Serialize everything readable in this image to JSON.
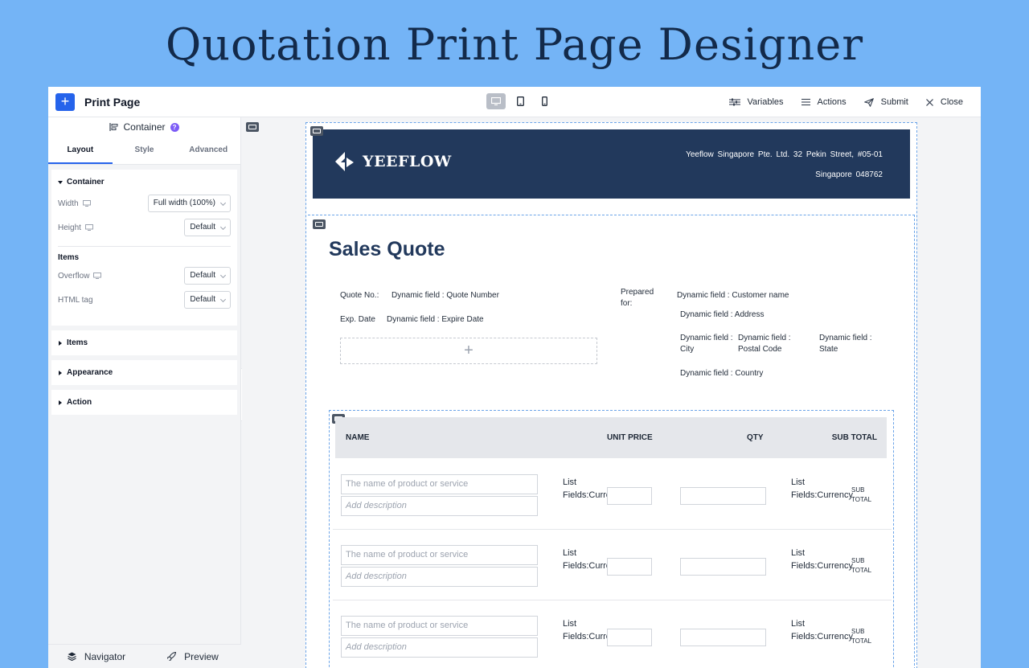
{
  "page": {
    "title": "Quotation Print Page Designer"
  },
  "topbar": {
    "add_label": "+",
    "title": "Print Page",
    "devices": [
      "desktop-icon",
      "tablet-icon",
      "mobile-icon"
    ],
    "actions": [
      {
        "label": "Variables",
        "icon": "sliders-icon"
      },
      {
        "label": "Actions",
        "icon": "list-icon"
      },
      {
        "label": "Submit",
        "icon": "send-icon"
      },
      {
        "label": "Close",
        "icon": "close-icon"
      }
    ]
  },
  "panel": {
    "heading": "Container",
    "help": "?",
    "tabs": [
      "Layout",
      "Style",
      "Advanced"
    ],
    "active_tab": "Layout",
    "container_section": {
      "title": "Container",
      "width": {
        "label": "Width",
        "value": "Full width (100%)"
      },
      "height": {
        "label": "Height",
        "value": "Default"
      },
      "items_title": "Items",
      "overflow": {
        "label": "Overflow",
        "value": "Default"
      },
      "html_tag": {
        "label": "HTML tag",
        "value": "Default"
      }
    },
    "collapsed_sections": [
      "Items",
      "Appearance",
      "Action"
    ],
    "footer": {
      "navigator": "Navigator",
      "preview": "Preview"
    }
  },
  "document": {
    "brand": "YEEFLOW",
    "company_line1": "Yeeflow Singapore Pte. Ltd.   32 Pekin Street, #05-01",
    "company_line2": "Singapore   048762",
    "heading": "Sales Quote",
    "quote_no_label": "Quote No.:",
    "quote_no_value": "Dynamic field : Quote Number",
    "exp_date_label": "Exp. Date",
    "exp_date_value": "Dynamic field : Expire Date",
    "drop_zone": "+",
    "prepared_for_label": "Prepared for:",
    "customer_name": "Dynamic field : Customer name",
    "address": "Dynamic field : Address",
    "city": "Dynamic field : City",
    "postal_code": "Dynamic field : Postal Code",
    "state": "Dynamic field : State",
    "country": "Dynamic field : Country"
  },
  "table": {
    "columns": [
      "NAME",
      "UNIT PRICE",
      "QTY",
      "SUB TOTAL"
    ],
    "rows": [
      {
        "name_placeholder": "The name of product or service",
        "desc_placeholder": "Add description",
        "price_text": "List Fields:Currency",
        "subtotal_text": "List Fields:Currency",
        "subtotal_label": "SUB TOTAL"
      },
      {
        "name_placeholder": "The name of product or service",
        "desc_placeholder": "Add description",
        "price_text": "List Fields:Currency",
        "subtotal_text": "List Fields:Currency",
        "subtotal_label": "SUB TOTAL"
      },
      {
        "name_placeholder": "The name of product or service",
        "desc_placeholder": "Add description",
        "price_text": "List Fields:Currency",
        "subtotal_text": "List Fields:Currency",
        "subtotal_label": "SUB TOTAL"
      }
    ]
  },
  "colors": {
    "brand_blue": "#2563eb",
    "header_navy": "#22395c",
    "background": "#74b4f6",
    "accent_purple": "#7c5cf6"
  }
}
